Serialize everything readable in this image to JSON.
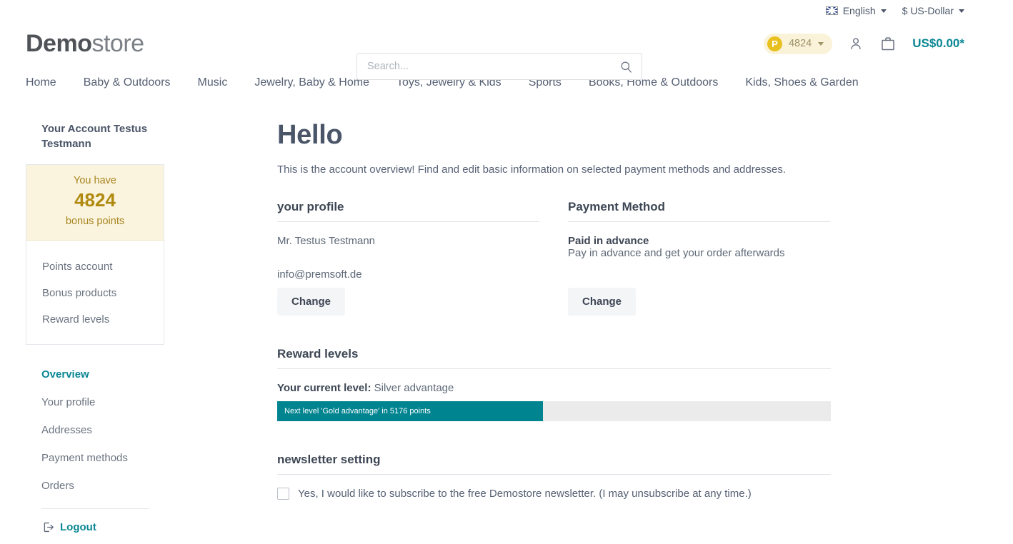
{
  "topbar": {
    "language": "English",
    "currency": "$ US-Dollar",
    "flag_icon": "uk-flag-icon"
  },
  "header": {
    "logo_bold": "Demo",
    "logo_light": "store",
    "search_placeholder": "Search...",
    "search_value": "",
    "search_icon": "search-icon",
    "points_badge_letter": "P",
    "points_badge_value": "4824",
    "account_icon": "user-icon",
    "cart_icon": "shopping-bag-icon",
    "cart_total": "US$0.00*"
  },
  "nav": {
    "items": [
      {
        "label": "Home"
      },
      {
        "label": "Baby & Outdoors"
      },
      {
        "label": "Music"
      },
      {
        "label": "Jewelry, Baby & Home"
      },
      {
        "label": "Toys, Jewelry & Kids"
      },
      {
        "label": "Sports"
      },
      {
        "label": "Books, Home & Outdoors"
      },
      {
        "label": "Kids, Shoes & Garden"
      }
    ]
  },
  "sidebar": {
    "account_title": "Your Account Testus Testmann",
    "bonus": {
      "have_label": "You have",
      "points": "4824",
      "points_label": "bonus points"
    },
    "bonus_links": [
      {
        "label": "Points account"
      },
      {
        "label": "Bonus products"
      },
      {
        "label": "Reward levels"
      }
    ],
    "account_nav": [
      {
        "label": "Overview",
        "active": true
      },
      {
        "label": "Your profile",
        "active": false
      },
      {
        "label": "Addresses",
        "active": false
      },
      {
        "label": "Payment methods",
        "active": false
      },
      {
        "label": "Orders",
        "active": false
      }
    ],
    "logout": {
      "label": "Logout",
      "icon": "logout-icon"
    }
  },
  "main": {
    "title": "Hello",
    "lead": "This is the account overview! Find and edit basic information on selected payment methods and addresses.",
    "profile": {
      "title": "your profile",
      "name": "Mr. Testus Testmann",
      "email": "info@premsoft.de",
      "change_label": "Change"
    },
    "payment": {
      "title": "Payment Method",
      "method_name": "Paid in advance",
      "method_desc": "Pay in advance and get your order afterwards",
      "change_label": "Change"
    },
    "reward": {
      "title": "Reward levels",
      "current_prefix": "Your current level",
      "current_sep": ": ",
      "current_level": "Silver advantage",
      "progress_text": "Next level 'Gold advantage' in 5176 points",
      "progress_percent": 48
    },
    "newsletter": {
      "title": "newsletter setting",
      "checkbox_label": "Yes, I would like to subscribe to the free Demostore newsletter. (I may unsubscribe at any time.)",
      "checked": false
    }
  },
  "colors": {
    "accent_teal": "#0b8793",
    "progress_teal": "#008490",
    "bonus_bg": "#faf3de",
    "bonus_text": "#a8861f",
    "badge_yellow": "#e8c020"
  }
}
